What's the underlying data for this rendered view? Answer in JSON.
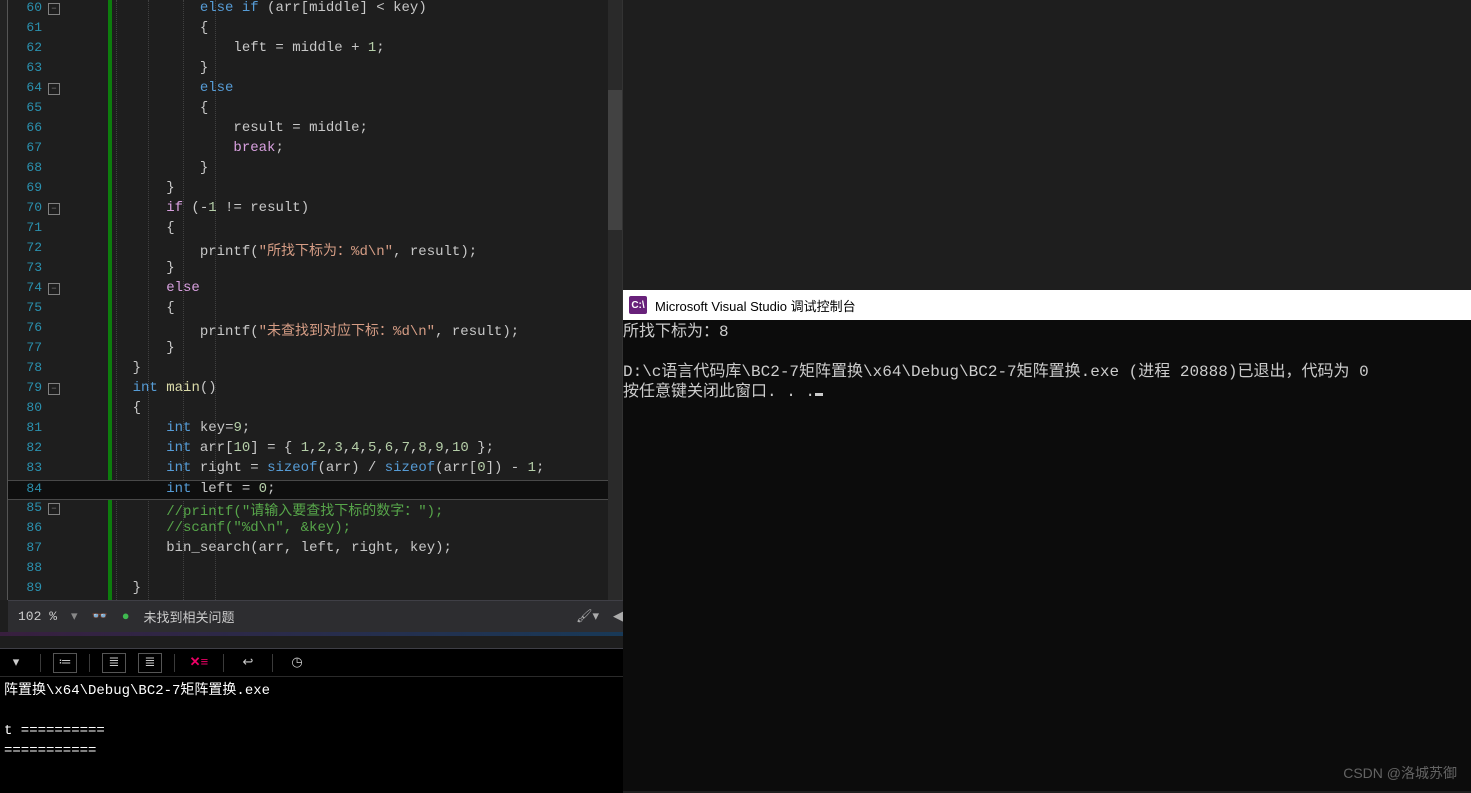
{
  "editor": {
    "zoom": "102 %",
    "status_text": "未找到相关问题",
    "lines": [
      {
        "n": 60,
        "fold": true,
        "code": [
          [
            "            ",
            ""
          ],
          [
            "else if",
            1
          ],
          [
            " (",
            0
          ],
          [
            "arr",
            0
          ],
          [
            "[",
            0
          ],
          [
            "middle",
            0
          ],
          [
            "] &lt; ",
            0
          ],
          [
            "key",
            0
          ],
          [
            ")",
            0
          ]
        ]
      },
      {
        "n": 61,
        "code": [
          [
            "            {",
            0
          ]
        ]
      },
      {
        "n": 62,
        "code": [
          [
            "                ",
            0
          ],
          [
            "left",
            0
          ],
          [
            " = ",
            0
          ],
          [
            "middle",
            0
          ],
          [
            " + ",
            0
          ],
          [
            "1",
            2
          ],
          [
            ";",
            0
          ]
        ]
      },
      {
        "n": 63,
        "code": [
          [
            "            }",
            0
          ]
        ]
      },
      {
        "n": 64,
        "fold": true,
        "code": [
          [
            "            ",
            0
          ],
          [
            "else",
            1
          ]
        ]
      },
      {
        "n": 65,
        "code": [
          [
            "            {",
            0
          ]
        ]
      },
      {
        "n": 66,
        "code": [
          [
            "                ",
            0
          ],
          [
            "result",
            0
          ],
          [
            " = ",
            0
          ],
          [
            "middle",
            0
          ],
          [
            ";",
            0
          ]
        ]
      },
      {
        "n": 67,
        "code": [
          [
            "                ",
            0
          ],
          [
            "break",
            3
          ],
          [
            ";",
            0
          ]
        ]
      },
      {
        "n": 68,
        "code": [
          [
            "            }",
            0
          ]
        ]
      },
      {
        "n": 69,
        "code": [
          [
            "        }",
            0
          ]
        ]
      },
      {
        "n": 70,
        "fold": true,
        "code": [
          [
            "        ",
            0
          ],
          [
            "if",
            3
          ],
          [
            " (-",
            0
          ],
          [
            "1",
            2
          ],
          [
            " != ",
            0
          ],
          [
            "result",
            0
          ],
          [
            ")",
            0
          ]
        ]
      },
      {
        "n": 71,
        "code": [
          [
            "        {",
            0
          ]
        ]
      },
      {
        "n": 72,
        "code": [
          [
            "            ",
            0
          ],
          [
            "printf",
            0
          ],
          [
            "(",
            0
          ],
          [
            "\"所找下标为：%d\\n\"",
            4
          ],
          [
            ", ",
            0
          ],
          [
            "result",
            0
          ],
          [
            ");",
            0
          ]
        ]
      },
      {
        "n": 73,
        "code": [
          [
            "        }",
            0
          ]
        ]
      },
      {
        "n": 74,
        "fold": true,
        "code": [
          [
            "        ",
            0
          ],
          [
            "else",
            3
          ]
        ]
      },
      {
        "n": 75,
        "code": [
          [
            "        {",
            0
          ]
        ]
      },
      {
        "n": 76,
        "code": [
          [
            "            ",
            0
          ],
          [
            "printf",
            0
          ],
          [
            "(",
            0
          ],
          [
            "\"未查找到对应下标：%d\\n\"",
            4
          ],
          [
            ", ",
            0
          ],
          [
            "result",
            0
          ],
          [
            ");",
            0
          ]
        ]
      },
      {
        "n": 77,
        "code": [
          [
            "        }",
            0
          ]
        ]
      },
      {
        "n": 78,
        "code": [
          [
            "    }",
            0
          ]
        ]
      },
      {
        "n": 79,
        "fold": true,
        "code": [
          [
            "    ",
            0
          ],
          [
            "int",
            1
          ],
          [
            " ",
            0
          ],
          [
            "main",
            6
          ],
          [
            "()",
            0
          ]
        ]
      },
      {
        "n": 80,
        "code": [
          [
            "    {",
            0
          ]
        ]
      },
      {
        "n": 81,
        "code": [
          [
            "        ",
            0
          ],
          [
            "int",
            1
          ],
          [
            " ",
            0
          ],
          [
            "key",
            0
          ],
          [
            "=",
            0
          ],
          [
            "9",
            2
          ],
          [
            ";",
            0
          ]
        ]
      },
      {
        "n": 82,
        "code": [
          [
            "        ",
            0
          ],
          [
            "int",
            1
          ],
          [
            " ",
            0
          ],
          [
            "arr",
            0
          ],
          [
            "[",
            0
          ],
          [
            "10",
            2
          ],
          [
            "] = { ",
            0
          ],
          [
            "1",
            2
          ],
          [
            ",",
            0
          ],
          [
            "2",
            2
          ],
          [
            ",",
            0
          ],
          [
            "3",
            2
          ],
          [
            ",",
            0
          ],
          [
            "4",
            2
          ],
          [
            ",",
            0
          ],
          [
            "5",
            2
          ],
          [
            ",",
            0
          ],
          [
            "6",
            2
          ],
          [
            ",",
            0
          ],
          [
            "7",
            2
          ],
          [
            ",",
            0
          ],
          [
            "8",
            2
          ],
          [
            ",",
            0
          ],
          [
            "9",
            2
          ],
          [
            ",",
            0
          ],
          [
            "10",
            2
          ],
          [
            " };",
            0
          ]
        ]
      },
      {
        "n": 83,
        "code": [
          [
            "        ",
            0
          ],
          [
            "int",
            1
          ],
          [
            " ",
            0
          ],
          [
            "right",
            0
          ],
          [
            " = ",
            0
          ],
          [
            "sizeof",
            1
          ],
          [
            "(",
            0
          ],
          [
            "arr",
            0
          ],
          [
            ") / ",
            0
          ],
          [
            "sizeof",
            1
          ],
          [
            "(",
            0
          ],
          [
            "arr",
            0
          ],
          [
            "[",
            0
          ],
          [
            "0",
            2
          ],
          [
            "]) - ",
            0
          ],
          [
            "1",
            2
          ],
          [
            ";",
            0
          ]
        ]
      },
      {
        "n": 84,
        "hl": true,
        "code": [
          [
            "        ",
            0
          ],
          [
            "int",
            1
          ],
          [
            " ",
            0
          ],
          [
            "left",
            0
          ],
          [
            " = ",
            0
          ],
          [
            "0",
            2
          ],
          [
            ";",
            0
          ]
        ]
      },
      {
        "n": 85,
        "fold": true,
        "code": [
          [
            "        ",
            0
          ],
          [
            "//printf(\"请输入要查找下标的数字：\");",
            5
          ]
        ]
      },
      {
        "n": 86,
        "code": [
          [
            "        ",
            0
          ],
          [
            "//scanf(\"%d\\n\", &key);",
            5
          ]
        ]
      },
      {
        "n": 87,
        "code": [
          [
            "        ",
            0
          ],
          [
            "bin_search",
            0
          ],
          [
            "(",
            0
          ],
          [
            "arr",
            0
          ],
          [
            ", ",
            0
          ],
          [
            "left",
            0
          ],
          [
            ", ",
            0
          ],
          [
            "right",
            0
          ],
          [
            ", ",
            0
          ],
          [
            "key",
            0
          ],
          [
            ");",
            0
          ]
        ]
      },
      {
        "n": 88,
        "code": [
          [
            "",
            0
          ]
        ]
      },
      {
        "n": 89,
        "code": [
          [
            "    }",
            0
          ]
        ]
      }
    ]
  },
  "cmd_panel": {
    "path": "阵置换\\x64\\Debug\\BC2-7矩阵置换.exe",
    "bars": "t ==========\n==========="
  },
  "console": {
    "title": "Microsoft Visual Studio 调试控制台",
    "line1": "所找下标为：8",
    "line2": "D:\\c语言代码库\\BC2-7矩阵置换\\x64\\Debug\\BC2-7矩阵置换.exe (进程 20888)已退出，代码为 0",
    "line3": "按任意键关闭此窗口. . ."
  },
  "watermark": "CSDN @洛城苏御"
}
